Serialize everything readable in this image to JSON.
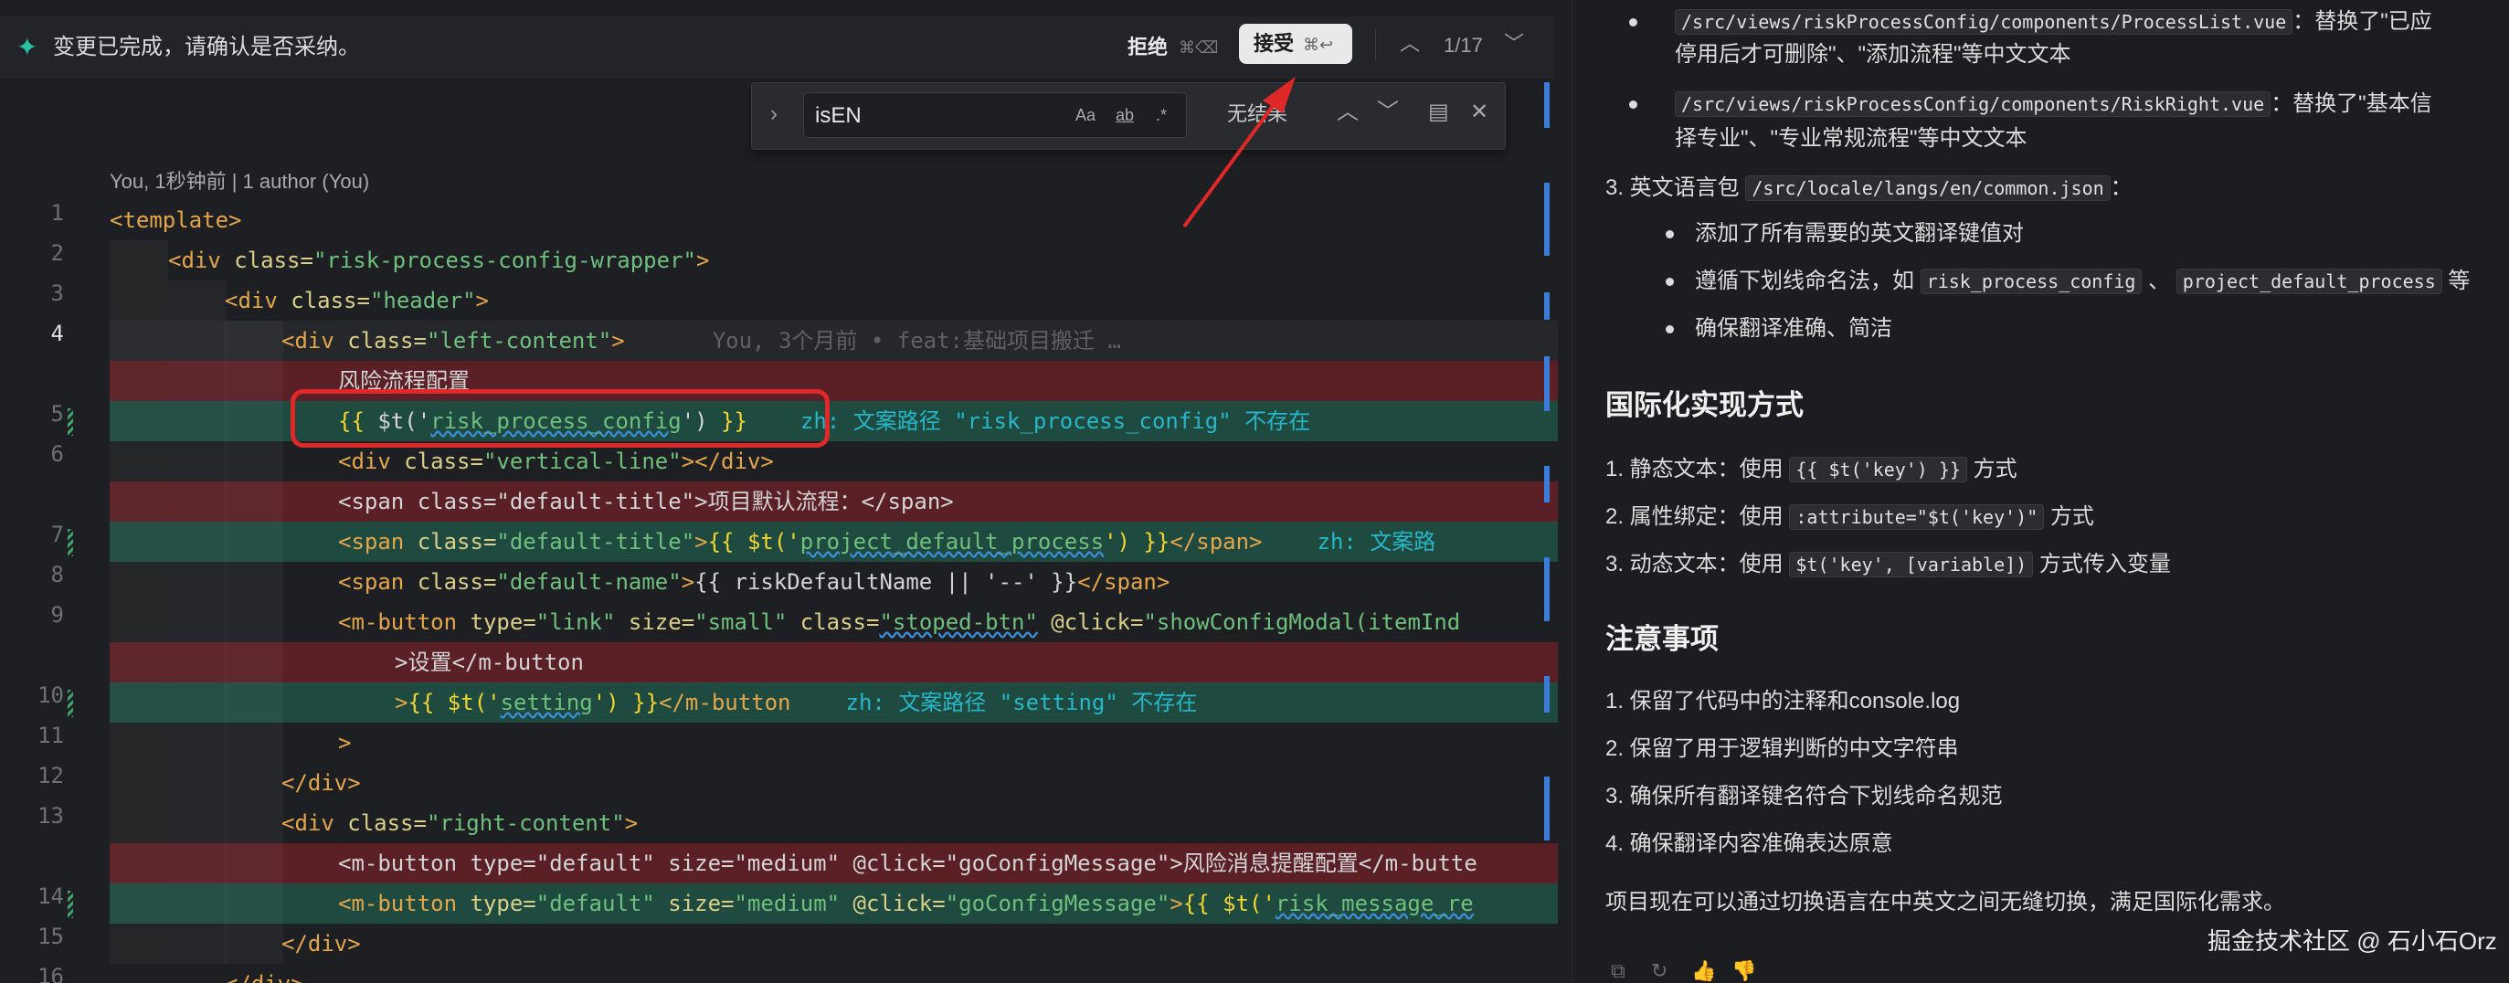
{
  "diff_bar": {
    "message": "变更已完成，请确认是否采纳。",
    "reject_label": "拒绝",
    "reject_shortcut": "⌘⌫",
    "accept_label": "接受",
    "accept_shortcut": "⌘↩",
    "change_counter": "1/17"
  },
  "find_widget": {
    "query": "isEN",
    "opt_case": "Aa",
    "opt_word": "ab",
    "opt_regex": ".*",
    "result_text": "无结果"
  },
  "editor": {
    "blame_header": "You, 1秒钟前 | 1 author (You)",
    "line_numbers": [
      "1",
      "2",
      "3",
      "4",
      "5",
      "6",
      "7",
      "8",
      "9",
      "10",
      "11",
      "12",
      "13",
      "14",
      "15",
      "16"
    ],
    "lines": {
      "l1": "<template>",
      "l2_tag": "<div",
      "l2_attr": " class=",
      "l2_str": "\"risk-process-config-wrapper\"",
      "l2_end": ">",
      "l3_tag": "<div",
      "l3_attr": " class=",
      "l3_str": "\"header\"",
      "l3_end": ">",
      "l4_tag": "<div",
      "l4_attr": " class=",
      "l4_str": "\"left-content\"",
      "l4_end": ">",
      "l4_blame": "You, 3个月前 • feat:基础项目搬迁 …",
      "del1": "风险流程配置",
      "l5_mus_open": "{{ ",
      "l5_fn": "$t('",
      "l5_key": "risk_process_config",
      "l5_fn_close": "')",
      "l5_mus_close": " }}",
      "l5_hint": "zh: 文案路径 \"risk_process_config\" 不存在",
      "l6_tag": "<div",
      "l6_attr": " class=",
      "l6_str": "\"vertical-line\"",
      "l6_end": "></div>",
      "del2": "<span class=\"default-title\">项目默认流程：</span>",
      "l7_tag": "<span",
      "l7_attr": " class=",
      "l7_str": "\"default-title\"",
      "l7_gt": ">",
      "l7_mus": "{{ $t('",
      "l7_key": "project_default_process",
      "l7_close": "') }}",
      "l7_endtag": "</span>",
      "l7_hint": "zh: 文案路",
      "l8_tag": "<span",
      "l8_attr": " class=",
      "l8_str": "\"default-name\"",
      "l8_gt": ">",
      "l8_mus": "{{ riskDefaultName || '--' }}",
      "l8_endtag": "</span>",
      "l9_tag": "<m-button",
      "l9_attr1": " type=",
      "l9_str1": "\"link\"",
      "l9_attr2": " size=",
      "l9_str2": "\"small\"",
      "l9_attr3": " class=",
      "l9_str3": "\"stoped-btn\"",
      "l9_attr4": " @click=",
      "l9_str4": "\"showConfigModal(itemInd",
      "del3": ">设置</m-button",
      "l10_gt": ">",
      "l10_mus": "{{ $t('",
      "l10_key": "setting",
      "l10_close": "') }}",
      "l10_end": "</m-button",
      "l10_hint": "zh: 文案路径 \"setting\" 不存在",
      "l11": ">",
      "l12": "</div>",
      "l13_tag": "<div",
      "l13_attr": " class=",
      "l13_str": "\"right-content\"",
      "l13_end": ">",
      "del4": "<m-button type=\"default\" size=\"medium\" @click=\"goConfigMessage\">风险消息提醒配置</m-butte",
      "l14_tag": "<m-button",
      "l14_attr1": " type=",
      "l14_str1": "\"default\"",
      "l14_attr2": " size=",
      "l14_str2": "\"medium\"",
      "l14_attr3": " @click=",
      "l14_str3": "\"goConfigMessage\"",
      "l14_gt": ">",
      "l14_mus": "{{ $t('",
      "l14_key": "risk_message_re",
      "l15": "</div>",
      "l16": "</div>"
    }
  },
  "chat": {
    "b1_path": "/src/views/riskProcessConfig/components/ProcessList.vue",
    "b1_text": "：替换了\"已应",
    "b1_cont": "停用后才可删除\"、\"添加流程\"等中文文本",
    "b2_path": "/src/views/riskProcessConfig/components/RiskRight.vue",
    "b2_text": "：替换了\"基本信",
    "b2_cont": "择专业\"、\"专业常规流程\"等中文文本",
    "item3_prefix": "3. 英文语言包",
    "item3_path": "/src/locale/langs/en/common.json",
    "item3_suffix": "：",
    "sub1": "添加了所有需要的英文翻译键值对",
    "sub2_prefix": "遵循下划线命名法，如",
    "sub2_code1": "risk_process_config",
    "sub2_sep": "、",
    "sub2_code2": "project_default_process",
    "sub2_tail": "等",
    "sub3": "确保翻译准确、简洁",
    "h_impl": "国际化实现方式",
    "impl1_prefix": "1. 静态文本：使用",
    "impl1_code": "{{ $t('key') }}",
    "impl1_suffix": "方式",
    "impl2_prefix": "2. 属性绑定：使用",
    "impl2_code": ":attribute=\"$t('key')\"",
    "impl2_suffix": "方式",
    "impl3_prefix": "3. 动态文本：使用",
    "impl3_code": "$t('key', [variable])",
    "impl3_suffix": "方式传入变量",
    "h_notes": "注意事项",
    "note1": "1. 保留了代码中的注释和console.log",
    "note2": "2. 保留了用于逻辑判断的中文字符串",
    "note3": "3. 确保所有翻译键名符合下划线命名规范",
    "note4": "4. 确保翻译内容准确表达原意",
    "summary": "项目现在可以通过切换语言在中英文之间无缝切换，满足国际化需求。",
    "watermark": "掘金技术社区 @ 石小石Orz"
  }
}
